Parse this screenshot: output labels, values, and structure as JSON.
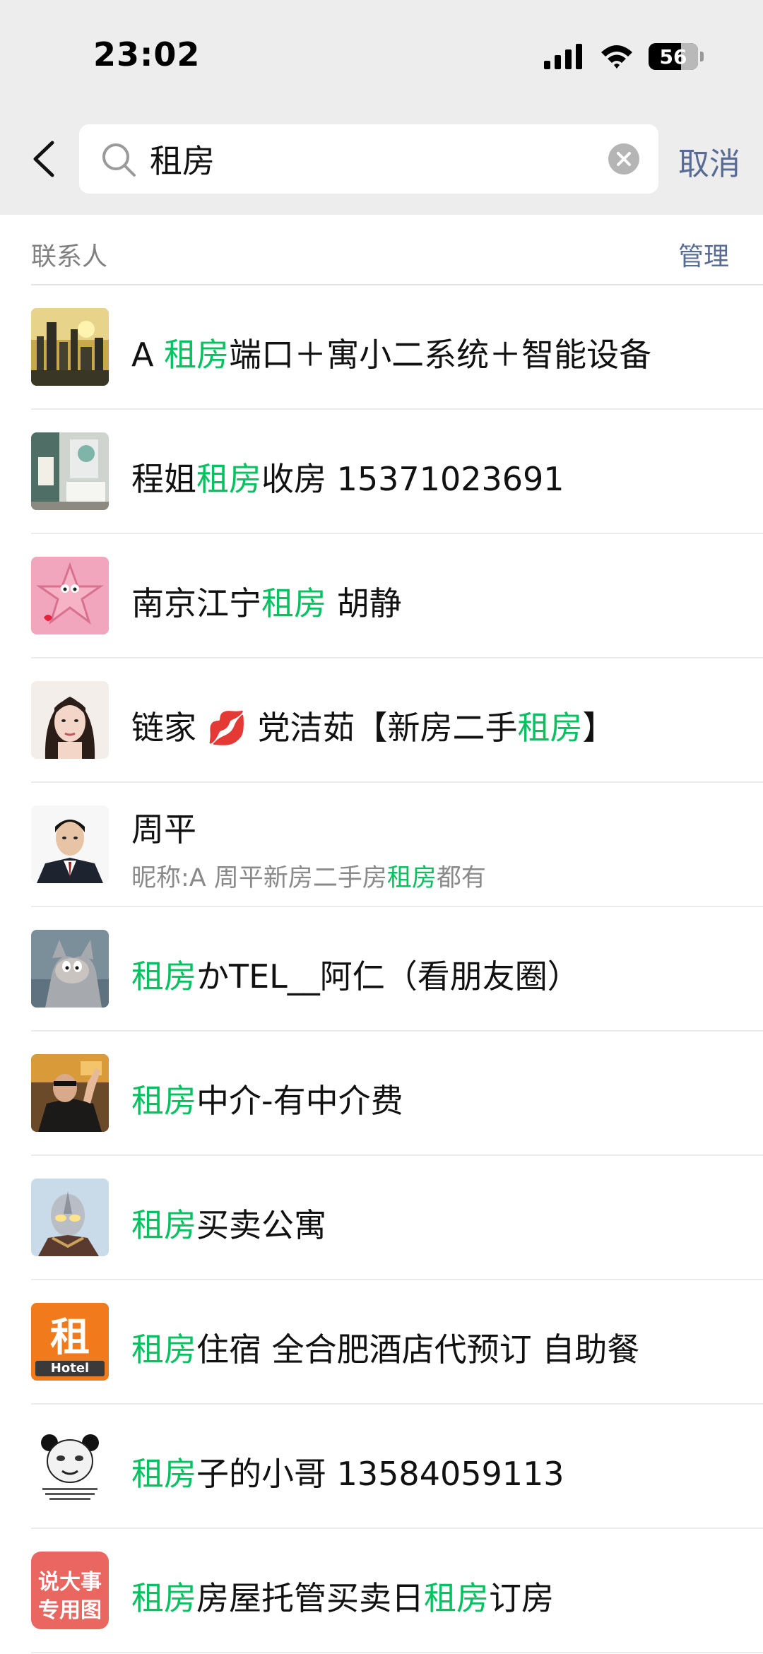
{
  "status_bar": {
    "time": "23:02",
    "battery": "56"
  },
  "search": {
    "query": "租房",
    "cancel_label": "取消"
  },
  "section": {
    "title": "联系人",
    "manage_label": "管理"
  },
  "highlight_color": "#07c160",
  "contacts": [
    {
      "avatar": "city-skyline-photo",
      "name": [
        {
          "t": "A "
        },
        {
          "t": "租房",
          "h": true
        },
        {
          "t": "端口＋寓小二系统＋智能设备"
        }
      ]
    },
    {
      "avatar": "room-interior-photo",
      "name": [
        {
          "t": "程姐"
        },
        {
          "t": "租房",
          "h": true
        },
        {
          "t": "收房 15371023691"
        }
      ]
    },
    {
      "avatar": "pink-cartoon-starfish",
      "name": [
        {
          "t": "南京江宁"
        },
        {
          "t": "租房",
          "h": true
        },
        {
          "t": " 胡静"
        }
      ]
    },
    {
      "avatar": "woman-portrait-photo",
      "name": [
        {
          "t": "链家 💋 党洁茹【新房二手"
        },
        {
          "t": "租房",
          "h": true
        },
        {
          "t": "】"
        }
      ]
    },
    {
      "avatar": "man-suit-portrait",
      "name": [
        {
          "t": "周平"
        }
      ],
      "sub": [
        {
          "t": "昵称:A 周平新房二手房"
        },
        {
          "t": "租房",
          "h": true
        },
        {
          "t": "都有"
        }
      ]
    },
    {
      "avatar": "cartoon-cat-tom",
      "name": [
        {
          "t": "租房",
          "h": true
        },
        {
          "t": "かTEL__阿仁（看朋友圈）"
        }
      ]
    },
    {
      "avatar": "man-waving-photo",
      "name": [
        {
          "t": "租房",
          "h": true
        },
        {
          "t": "中介-有中介费"
        }
      ]
    },
    {
      "avatar": "ultraman-figure",
      "name": [
        {
          "t": "租房",
          "h": true
        },
        {
          "t": "买卖公寓"
        }
      ]
    },
    {
      "avatar": "orange-hotel-sign",
      "avatar_text": "租",
      "avatar_sub": "Hotel",
      "name": [
        {
          "t": "租房",
          "h": true
        },
        {
          "t": "住宿 全合肥酒店代预订 自助餐"
        }
      ]
    },
    {
      "avatar": "panda-meme-face",
      "name": [
        {
          "t": "租房",
          "h": true
        },
        {
          "t": "子的小哥 13584059113"
        }
      ]
    },
    {
      "avatar": "red-text-badge",
      "avatar_text": "说大事\n专用图",
      "name": [
        {
          "t": "租房",
          "h": true
        },
        {
          "t": "房屋托管买卖日"
        },
        {
          "t": "租房",
          "h": true
        },
        {
          "t": "订房"
        }
      ]
    }
  ]
}
